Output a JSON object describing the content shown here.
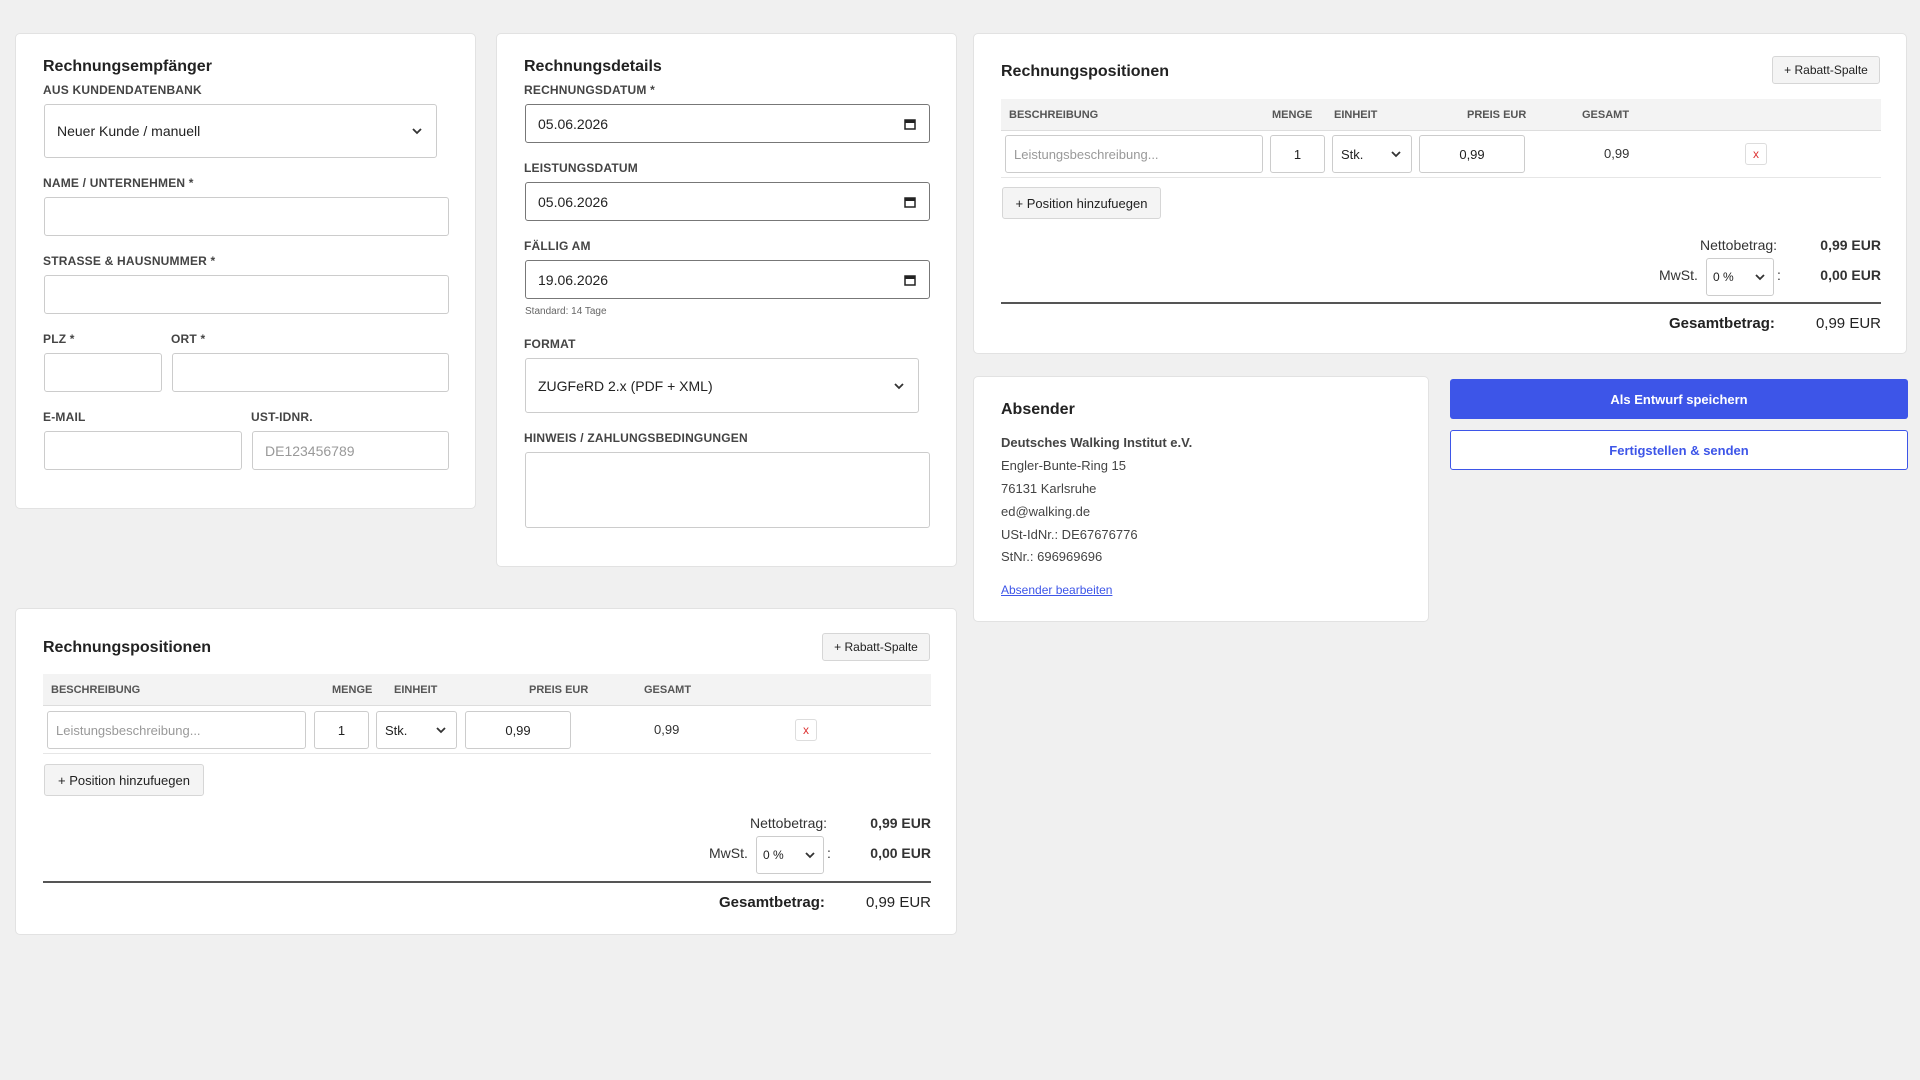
{
  "recipient": {
    "title": "Rechnungsempfänger",
    "db_label": "AUS KUNDENDATENBANK",
    "db_value": "Neuer Kunde / manuell",
    "name_label": "NAME / UNTERNEHMEN *",
    "name_value": "",
    "street_label": "STRASSE & HAUSNUMMER *",
    "street_value": "",
    "zip_label": "PLZ *",
    "zip_value": "",
    "city_label": "ORT *",
    "city_value": "",
    "email_label": "E-MAIL",
    "email_value": "",
    "vat_label": "UST-IDNR.",
    "vat_placeholder": "DE123456789"
  },
  "details": {
    "title": "Rechnungsdetails",
    "date_label": "RECHNUNGSDATUM *",
    "date_value": "05.06.2026",
    "service_label": "LEISTUNGSDATUM",
    "service_value": "05.06.2026",
    "due_label": "FÄLLIG AM",
    "due_value": "19.06.2026",
    "due_hint": "Standard: 14 Tage",
    "format_label": "FORMAT",
    "format_value": "ZUGFeRD 2.x (PDF + XML)",
    "note_label": "HINWEIS / ZAHLUNGSBEDINGUNGEN",
    "note_value": ""
  },
  "positions": {
    "title": "Rechnungspositionen",
    "rabatt_button": "+ Rabatt-Spalte",
    "headers": {
      "description": "BESCHREIBUNG",
      "quantity": "MENGE",
      "unit": "EINHEIT",
      "price": "PREIS EUR",
      "total": "GESAMT"
    },
    "row": {
      "description_placeholder": "Leistungsbeschreibung...",
      "quantity": "1",
      "unit": "Stk.",
      "price": "0,99",
      "total": "0,99",
      "delete": "x"
    },
    "add_button": "+ Position hinzufuegen",
    "net_label": "Nettobetrag:",
    "net_value": "0,99 EUR",
    "vat_label": "MwSt.",
    "vat_rate": "0 %",
    "vat_colon": ":",
    "vat_value": "0,00 EUR",
    "total_label": "Gesamtbetrag:",
    "total_value": "0,99 EUR"
  },
  "sender": {
    "title": "Absender",
    "name": "Deutsches Walking Institut e.V.",
    "street": "Engler-Bunte-Ring 15",
    "city": "76131 Karlsruhe",
    "email": "ed@walking.de",
    "vat_id": "USt-IdNr.: DE67676776",
    "tax_no": "StNr.: 696969696",
    "edit_link": "Absender bearbeiten"
  },
  "actions": {
    "draft_button": "Als Entwurf speichern",
    "finish_button": "Fertigstellen & senden"
  },
  "colors": {
    "primary": "#3d55e8",
    "delete": "#dd3333"
  }
}
